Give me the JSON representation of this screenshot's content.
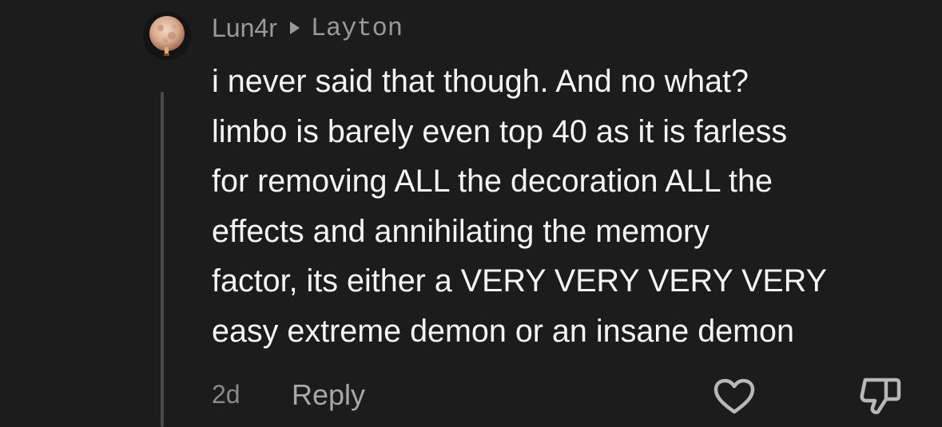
{
  "comment": {
    "author": "Lun4r",
    "reply_to": "Layton",
    "body_lines": [
      "i never said that though. And no what?",
      "limbo is barely even top 40 as it is farless",
      "for removing ALL the decoration ALL the",
      "effects and annihilating the memory",
      "factor, its either a VERY VERY VERY VERY",
      "easy extreme demon or an insane demon"
    ],
    "timestamp": "2d",
    "reply_label": "Reply"
  },
  "icons": {
    "avatar": "moon-avatar",
    "reply_arrow": "play-triangle-icon",
    "like": "heart-icon",
    "dislike": "thumbs-down-icon"
  },
  "colors": {
    "background": "#1c1c1c",
    "text": "#f5f5f5",
    "muted": "#9a9a9a"
  }
}
